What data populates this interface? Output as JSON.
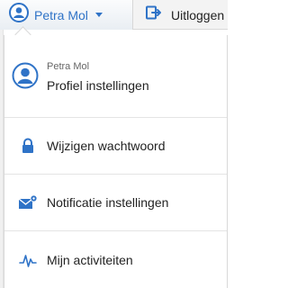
{
  "header": {
    "user_label": "Petra Mol",
    "logout_label": "Uitloggen"
  },
  "dropdown": {
    "profile": {
      "name": "Petra Mol",
      "action_label": "Profiel instellingen"
    },
    "items": [
      {
        "label": "Wijzigen wachtwoord",
        "icon": "lock-icon"
      },
      {
        "label": "Notificatie instellingen",
        "icon": "mail-settings-icon"
      },
      {
        "label": "Mijn activiteiten",
        "icon": "activity-icon"
      }
    ]
  },
  "colors": {
    "accent": "#2f73c7",
    "text": "#222222",
    "muted": "#666666"
  }
}
